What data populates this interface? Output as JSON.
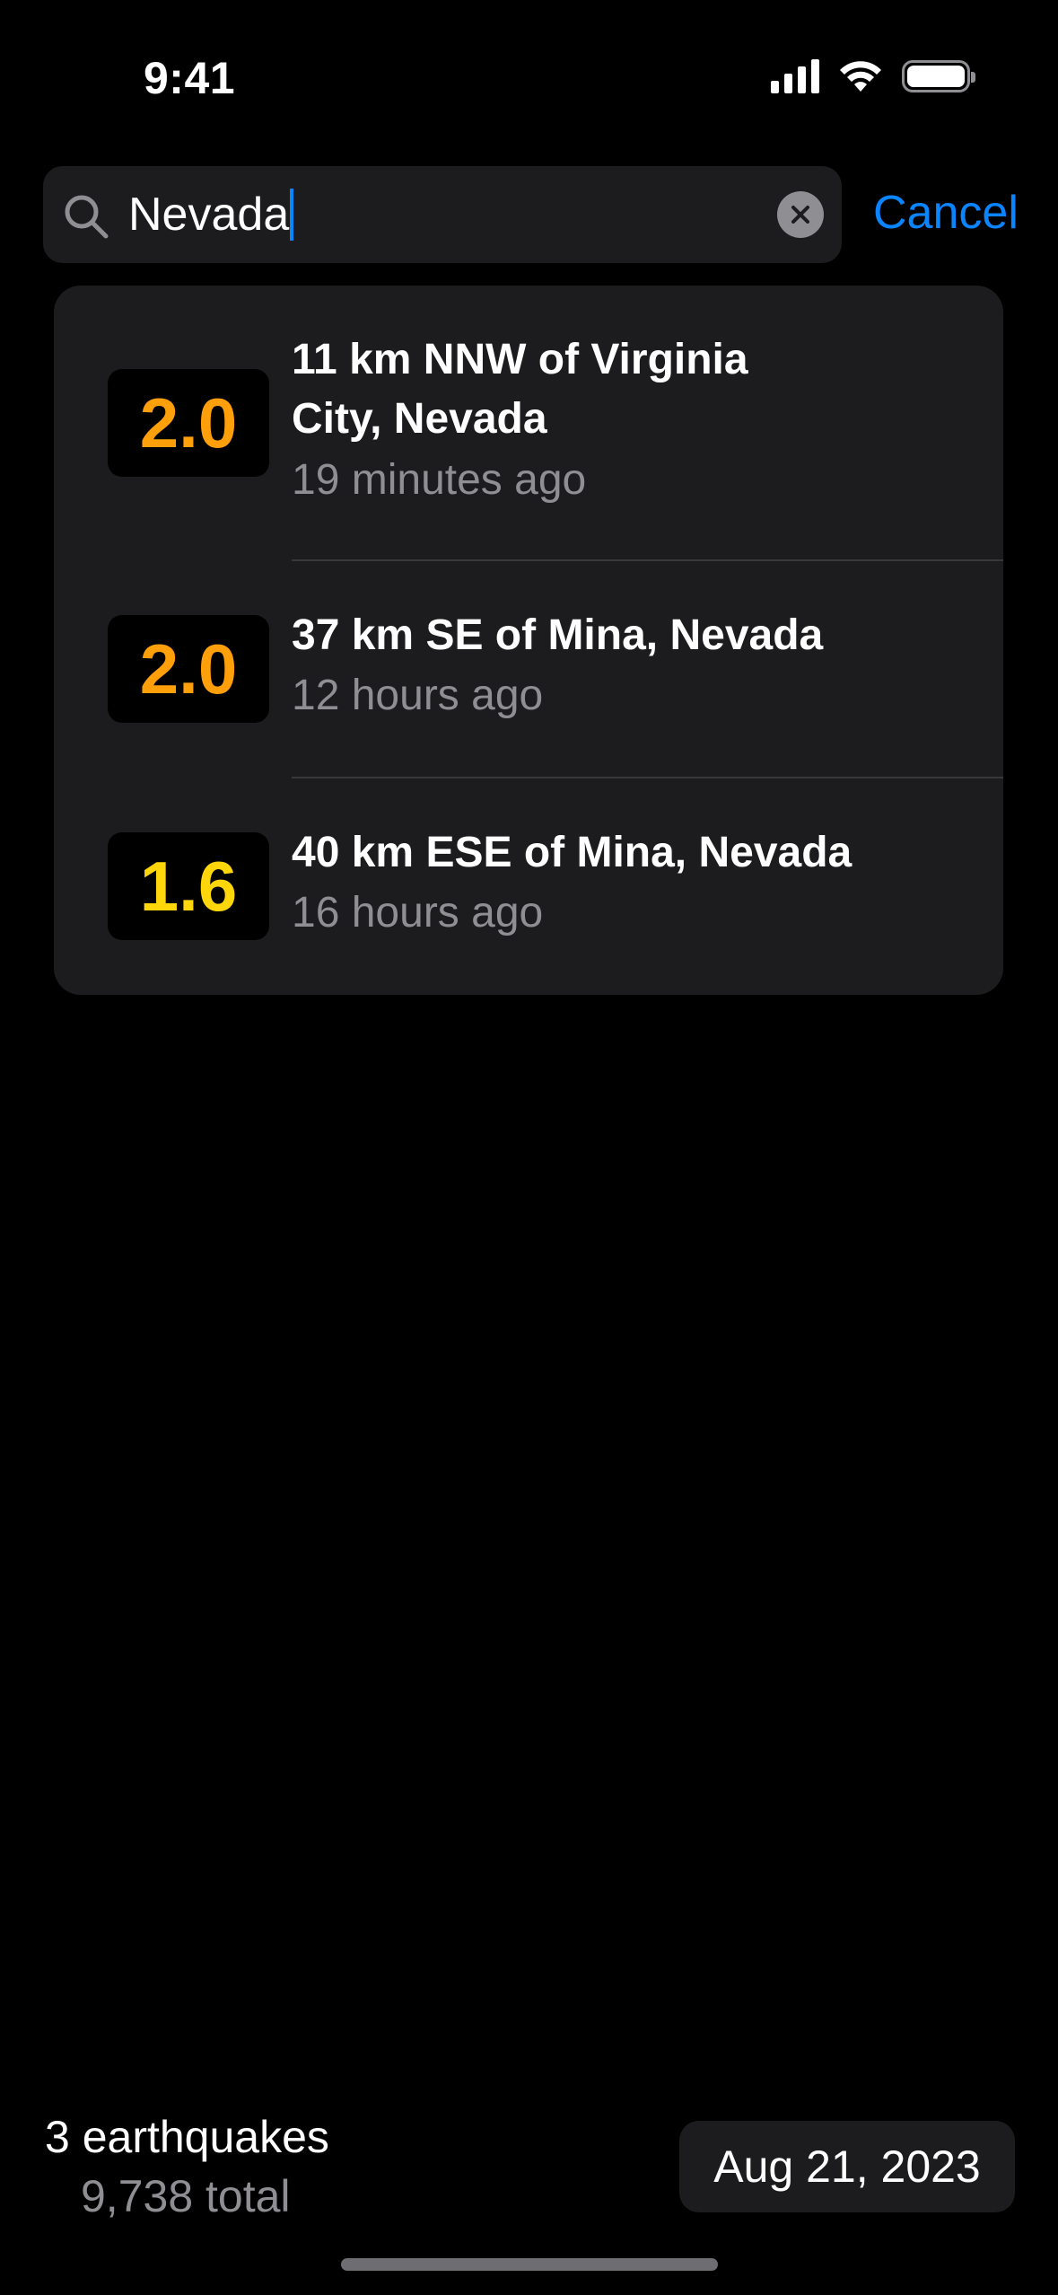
{
  "status_bar": {
    "time": "9:41",
    "icons": [
      "cellular-signal-icon",
      "wifi-icon",
      "battery-icon"
    ]
  },
  "search": {
    "value": "Nevada",
    "cancel_label": "Cancel",
    "icons": {
      "search": "magnifying-glass-icon",
      "clear": "x-circle-icon"
    }
  },
  "results": [
    {
      "magnitude": "2.0",
      "magnitude_color": "#ff9f0a",
      "place": "11 km NNW of Virginia City, Nevada",
      "time_ago": "19 minutes ago"
    },
    {
      "magnitude": "2.0",
      "magnitude_color": "#ff9f0a",
      "place": "37 km SE of Mina, Nevada",
      "time_ago": "12 hours ago"
    },
    {
      "magnitude": "1.6",
      "magnitude_color": "#ffd60a",
      "place": "40 km ESE of Mina, Nevada",
      "time_ago": "16 hours ago"
    }
  ],
  "footer": {
    "count_label": "3 earthquakes",
    "total_label": "9,738 total",
    "date_label": "Aug 21, 2023"
  },
  "colors": {
    "background": "#000000",
    "card": "#1c1c1e",
    "accent": "#0a84ff",
    "secondary_text": "#8e8e93"
  }
}
